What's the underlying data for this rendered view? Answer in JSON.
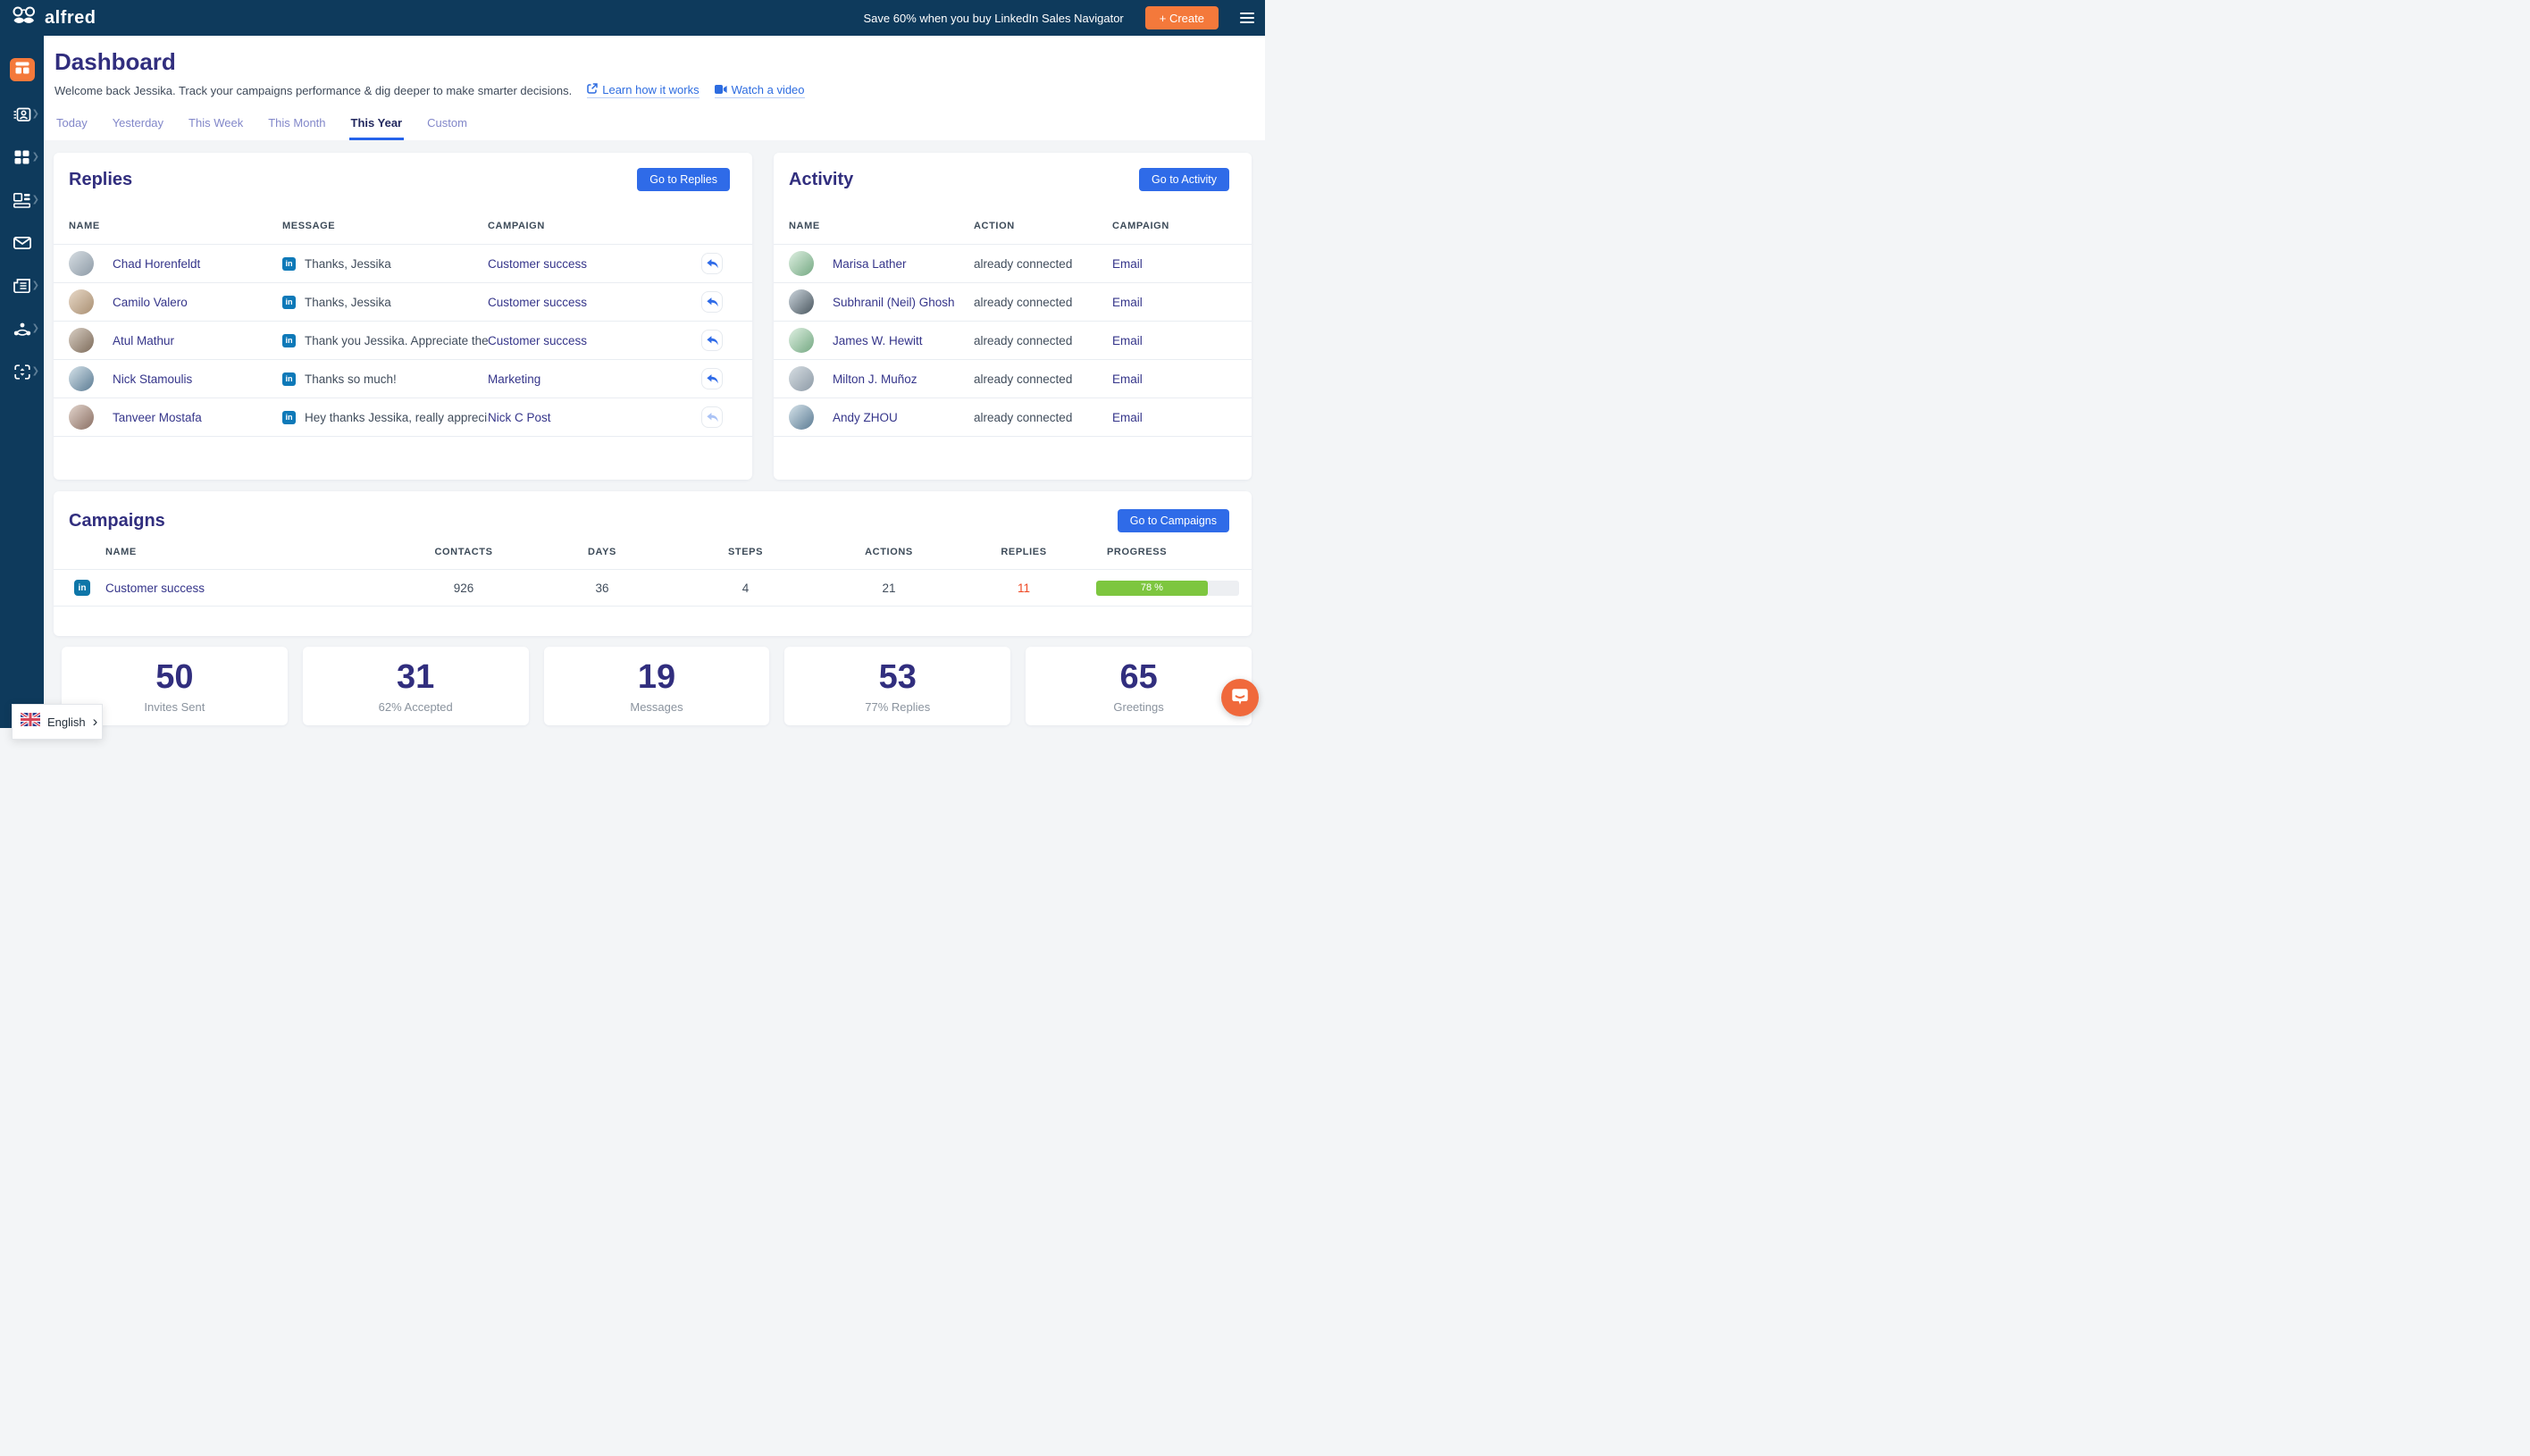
{
  "header": {
    "logo_text": "alfred",
    "promo": "Save 60% when you buy LinkedIn Sales Navigator",
    "create_label": "+ Create"
  },
  "sidebar": {
    "items": [
      {
        "icon": "dashboard-icon",
        "active": true
      },
      {
        "icon": "prospects-icon"
      },
      {
        "icon": "campaigns-icon"
      },
      {
        "icon": "templates-icon"
      },
      {
        "icon": "inbox-icon"
      },
      {
        "icon": "posts-icon"
      },
      {
        "icon": "network-icon"
      },
      {
        "icon": "integrations-icon"
      }
    ]
  },
  "page": {
    "title": "Dashboard",
    "welcome": "Welcome back Jessika. Track your campaigns performance & dig deeper to make smarter decisions.",
    "learn_link": "Learn how it works",
    "video_link": "Watch a video",
    "tabs": [
      {
        "label": "Today"
      },
      {
        "label": "Yesterday"
      },
      {
        "label": "This Week"
      },
      {
        "label": "This Month"
      },
      {
        "label": "This Year"
      },
      {
        "label": "Custom"
      }
    ],
    "active_tab": "This Year"
  },
  "replies": {
    "title": "Replies",
    "cta": "Go to Replies",
    "columns": {
      "name": "NAME",
      "message": "MESSAGE",
      "campaign": "CAMPAIGN"
    },
    "rows": [
      {
        "name": "Chad Horenfeldt",
        "message": "Thanks, Jessika",
        "campaign": "Customer success"
      },
      {
        "name": "Camilo Valero",
        "message": "Thanks, Jessika",
        "campaign": "Customer success"
      },
      {
        "name": "Atul Mathur",
        "message": "Thank you Jessika. Appreciate the w...",
        "campaign": "Customer success"
      },
      {
        "name": "Nick Stamoulis",
        "message": "Thanks so much!",
        "campaign": "Marketing"
      },
      {
        "name": "Tanveer Mostafa",
        "message": "Hey thanks Jessika, really appreciat...",
        "campaign": "Nick C Post"
      }
    ]
  },
  "activity": {
    "title": "Activity",
    "cta": "Go to Activity",
    "columns": {
      "name": "NAME",
      "action": "ACTION",
      "campaign": "CAMPAIGN"
    },
    "rows": [
      {
        "name": "Marisa Lather",
        "action": "already connected",
        "campaign": "Email"
      },
      {
        "name": "Subhranil (Neil) Ghosh",
        "action": "already connected",
        "campaign": "Email"
      },
      {
        "name": "James W. Hewitt",
        "action": "already connected",
        "campaign": "Email"
      },
      {
        "name": "Milton J. Muñoz",
        "action": "already connected",
        "campaign": "Email"
      },
      {
        "name": "Andy ZHOU",
        "action": "already connected",
        "campaign": "Email"
      }
    ]
  },
  "campaigns": {
    "title": "Campaigns",
    "cta": "Go to Campaigns",
    "columns": {
      "name": "NAME",
      "contacts": "CONTACTS",
      "days": "DAYS",
      "steps": "STEPS",
      "actions": "ACTIONS",
      "replies": "REPLIES",
      "progress": "PROGRESS"
    },
    "rows": [
      {
        "name": "Customer success",
        "contacts": "926",
        "days": "36",
        "steps": "4",
        "actions": "21",
        "replies": "11",
        "progress_label": "78 %",
        "progress_pct": 78
      }
    ]
  },
  "stats": [
    {
      "value": "50",
      "label": "Invites Sent"
    },
    {
      "value": "31",
      "label": "62% Accepted"
    },
    {
      "value": "19",
      "label": "Messages"
    },
    {
      "value": "53",
      "label": "77% Replies"
    },
    {
      "value": "65",
      "label": "Greetings"
    }
  ],
  "language": {
    "label": "English"
  },
  "colors": {
    "navy": "#0e3a5c",
    "orange": "#f4793b",
    "accent_blue": "#2f6be8",
    "indigo": "#312e7e",
    "green": "#7dc63f",
    "red": "#ee4823",
    "linkedin_blue": "#0e79b8"
  }
}
